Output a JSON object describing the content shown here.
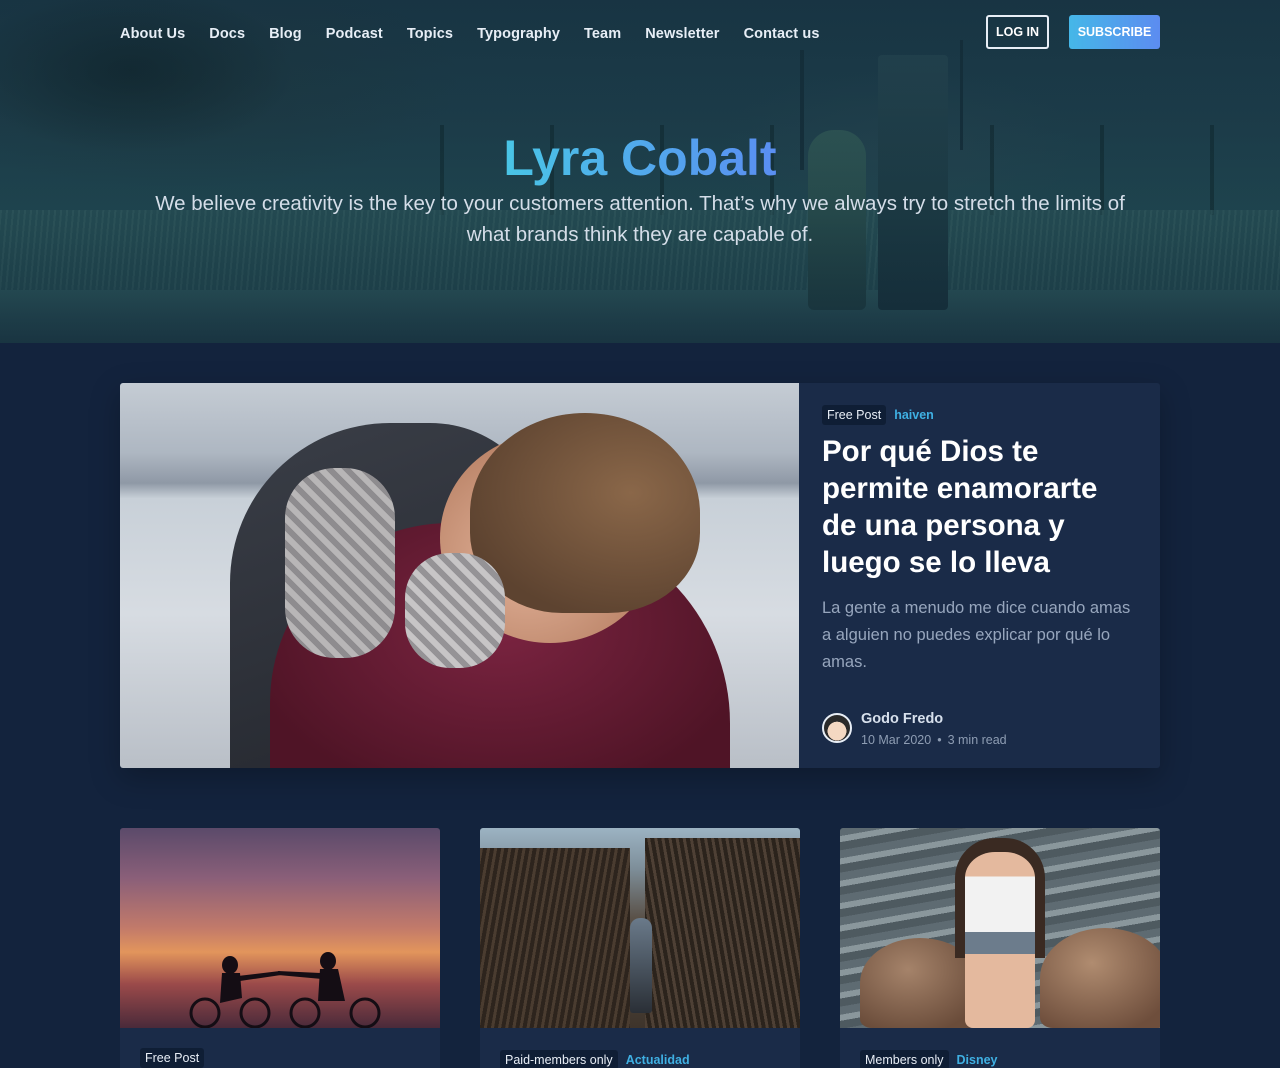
{
  "nav": {
    "items": [
      "About Us",
      "Docs",
      "Blog",
      "Podcast",
      "Topics",
      "Typography",
      "Team",
      "Newsletter",
      "Contact us"
    ],
    "login_label": "LOG IN",
    "subscribe_label": "SUBSCRIBE"
  },
  "hero": {
    "title": "Lyra Cobalt",
    "description": "We believe creativity is the key to your customers attention. That’s why we always try to stretch the limits of what brands think they are capable of."
  },
  "featured": {
    "tag": "Free Post",
    "category": "haiven",
    "title": "Por qué Dios te permite enamorarte de una persona y luego se lo lleva",
    "excerpt": "La gente a menudo me dice cuando amas a alguien no puedes explicar por qué lo amas.",
    "author": "Godo Fredo",
    "date": "10 Mar 2020",
    "dot": "•",
    "read_time": "3 min read"
  },
  "cards": [
    {
      "tag": "Free Post",
      "category": ""
    },
    {
      "tag": "Paid-members only",
      "category": "Actualidad"
    },
    {
      "tag": "Members only",
      "category": "Disney"
    }
  ],
  "colors": {
    "background": "#13233d",
    "card": "#1a2b48",
    "accent": "#3fb0e3",
    "gradient_start": "#45b7e8",
    "gradient_end": "#5c8cf0"
  }
}
